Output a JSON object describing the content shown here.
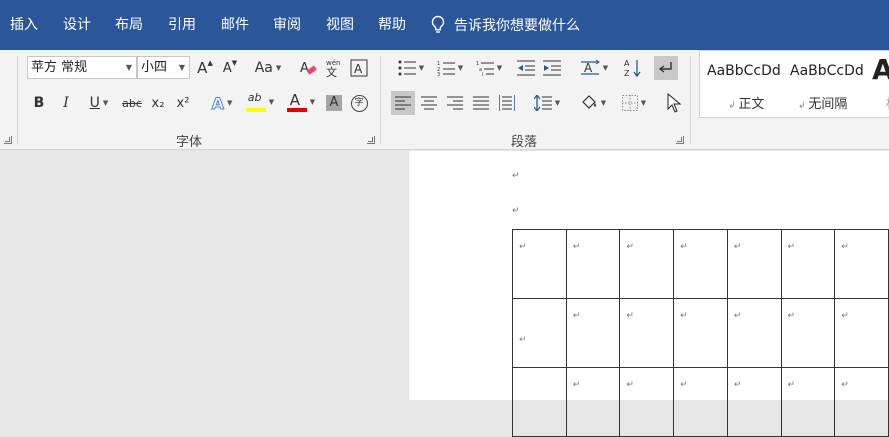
{
  "tabs": [
    "插入",
    "设计",
    "布局",
    "引用",
    "邮件",
    "审阅",
    "视图",
    "帮助"
  ],
  "tell_me": "告诉我你想要做什么",
  "font": {
    "name": "苹方 常规",
    "size": "小四",
    "grow": "A",
    "shrink": "A",
    "change_case": "Aa",
    "phonetic_glyph": "wén",
    "bold": "B",
    "italic": "I",
    "underline": "U",
    "strike": "abc",
    "subscript": "x₂",
    "superscript": "x²",
    "effects": "A",
    "highlight": "ab",
    "color": "A",
    "shading": "A",
    "enclose": "字",
    "group_label": "字体"
  },
  "paragraph": {
    "group_label": "段落"
  },
  "styles": {
    "items": [
      {
        "sample": "AaBbCcDd",
        "name": "正文"
      },
      {
        "sample": "AaBbCcDd",
        "name": "无间隔"
      },
      {
        "sample": "A",
        "name": "标"
      }
    ]
  },
  "colors": {
    "ribbon_tab_bg": "#2b579a",
    "highlight_yellow": "#ffff00",
    "font_red": "#e00000",
    "effects_blue": "#4a7bd0"
  },
  "document": {
    "paragraph_mark": "↵"
  }
}
